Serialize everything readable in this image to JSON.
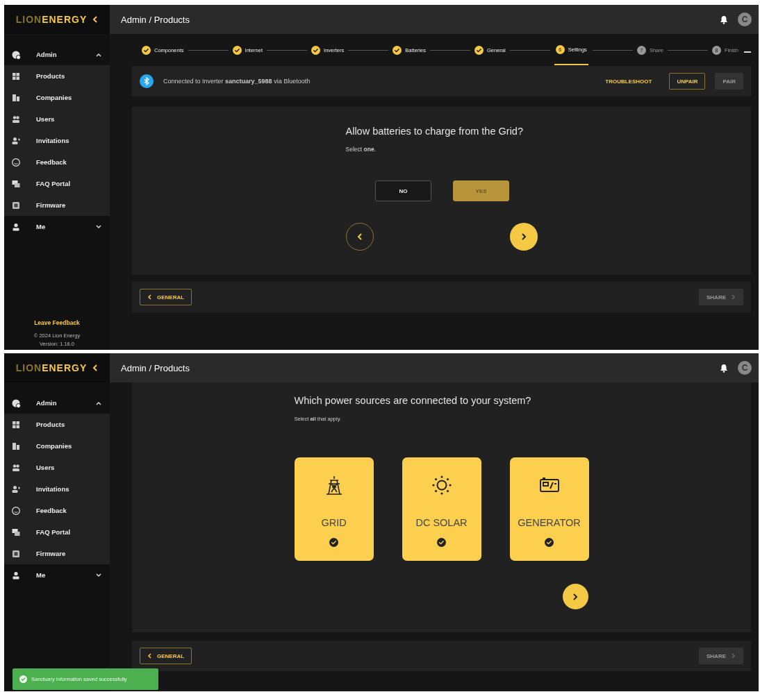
{
  "screens": [
    {
      "logo": {
        "dim": "LION",
        "bright": "ENERGY"
      },
      "breadcrumb": "Admin / Products",
      "avatar": "C",
      "sidebar": {
        "items": [
          {
            "label": "Admin",
            "kind": "admin",
            "expanded": true,
            "children": [
              {
                "label": "Products",
                "kind": "products"
              },
              {
                "label": "Companies",
                "kind": "companies"
              },
              {
                "label": "Users",
                "kind": "users"
              },
              {
                "label": "Invitations",
                "kind": "invitations"
              },
              {
                "label": "Feedback",
                "kind": "feedback"
              },
              {
                "label": "FAQ Portal",
                "kind": "faq"
              },
              {
                "label": "Firmware",
                "kind": "firmware"
              }
            ]
          },
          {
            "label": "Me",
            "kind": "me",
            "expanded": false
          }
        ],
        "leave_feedback": "Leave Feedback",
        "copyright": "© 2024 Lion Energy",
        "version": "Version: 1.16.0"
      },
      "stepper": [
        {
          "label": "Components",
          "completed": true,
          "selected": false
        },
        {
          "label": "Internet",
          "completed": true,
          "selected": false
        },
        {
          "label": "Inverters",
          "completed": true,
          "selected": false
        },
        {
          "label": "Batteries",
          "completed": true,
          "selected": false
        },
        {
          "label": "General",
          "completed": true,
          "selected": false
        },
        {
          "label": "Settings",
          "completed": false,
          "selected": true,
          "number": "6"
        },
        {
          "label": "Share",
          "completed": false,
          "selected": false,
          "number": "7"
        },
        {
          "label": "Finish",
          "completed": false,
          "selected": false,
          "number": "8"
        }
      ],
      "connection": {
        "text": "Connected to Inverter **sanctuary_5988** via Bluetooth",
        "actions": [
          {
            "label": "TROUBLESHOOT",
            "kind": "text",
            "disabled": false
          },
          {
            "label": "UNPAIR",
            "kind": "outlined",
            "disabled": false
          },
          {
            "label": "PAIR",
            "kind": "filled",
            "disabled": true
          }
        ]
      },
      "question": {
        "title": "Allow batteries to charge from the Grid?",
        "subtitle": "Select **one**.",
        "back_arrow": true,
        "options": [
          {
            "label": "NO",
            "selected": false
          },
          {
            "label": "YES",
            "selected": true
          }
        ]
      },
      "footer": {
        "back": {
          "label": "GENERAL",
          "disabled": false
        },
        "next": {
          "label": "SHARE",
          "disabled": true
        }
      }
    },
    {
      "logo": {
        "dim": "LION",
        "bright": "ENERGY"
      },
      "breadcrumb": "Admin / Products",
      "avatar": "C",
      "sidebar": {
        "items": [
          {
            "label": "Admin",
            "kind": "admin",
            "expanded": true,
            "children": [
              {
                "label": "Products",
                "kind": "products"
              },
              {
                "label": "Companies",
                "kind": "companies"
              },
              {
                "label": "Users",
                "kind": "users"
              },
              {
                "label": "Invitations",
                "kind": "invitations"
              },
              {
                "label": "Feedback",
                "kind": "feedback"
              },
              {
                "label": "FAQ Portal",
                "kind": "faq"
              },
              {
                "label": "Firmware",
                "kind": "firmware"
              }
            ]
          },
          {
            "label": "Me",
            "kind": "me",
            "expanded": false
          }
        ]
      },
      "question": {
        "title": "Which power sources are connected to your system?",
        "subtitle": "Select **all** that apply.",
        "sources": [
          {
            "label": "GRID",
            "kind": "grid",
            "selected": true
          },
          {
            "label": "DC SOLAR",
            "kind": "solar",
            "selected": true
          },
          {
            "label": "GENERATOR",
            "kind": "generator",
            "selected": true
          }
        ]
      },
      "footer": {
        "back": {
          "label": "GENERAL",
          "disabled": false
        },
        "next": {
          "label": "SHARE",
          "disabled": true
        }
      },
      "toast": {
        "text": "Sanctuary information saved successfully"
      }
    }
  ]
}
